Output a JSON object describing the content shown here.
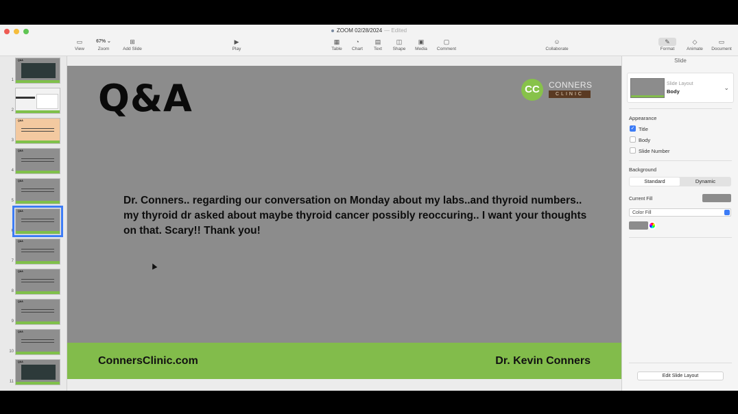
{
  "window": {
    "title": "ZOOM 02/28/2024",
    "status": "Edited"
  },
  "toolbar": {
    "view": "View",
    "zoom_value": "67%",
    "zoom": "Zoom",
    "add_slide": "Add Slide",
    "play": "Play",
    "table": "Table",
    "chart": "Chart",
    "text": "Text",
    "shape": "Shape",
    "media": "Media",
    "comment": "Comment",
    "collaborate": "Collaborate",
    "format": "Format",
    "animate": "Animate",
    "document": "Document"
  },
  "navigator": {
    "slides": [
      {
        "num": "1",
        "title": "Q&A",
        "style": "dark"
      },
      {
        "num": "2",
        "title": "",
        "style": "doc"
      },
      {
        "num": "3",
        "title": "Q&A",
        "style": "peach"
      },
      {
        "num": "4",
        "title": "Q&A",
        "style": "grey"
      },
      {
        "num": "5",
        "title": "Q&A",
        "style": "grey"
      },
      {
        "num": "6",
        "title": "Q&A",
        "style": "grey",
        "selected": true
      },
      {
        "num": "7",
        "title": "Q&A",
        "style": "grey"
      },
      {
        "num": "8",
        "title": "Q&A",
        "style": "grey"
      },
      {
        "num": "9",
        "title": "Q&A",
        "style": "grey"
      },
      {
        "num": "10",
        "title": "Q&A",
        "style": "grey"
      },
      {
        "num": "11",
        "title": "Q&A",
        "style": "dark"
      }
    ]
  },
  "slide": {
    "title": "Q&A",
    "body": "Dr. Conners.. regarding our conversation on Monday about my labs..and thyroid numbers.. my thyroid dr asked about maybe thyroid cancer possibly reoccuring.. I want your thoughts on that. Scary!! Thank you!",
    "footer_left": "ConnersClinic.com",
    "footer_right": "Dr. Kevin Conners",
    "logo_mark": "CC",
    "logo_top": "CONNERS",
    "logo_bottom": "CLINIC"
  },
  "inspector": {
    "header": "Slide",
    "layout_label": "Slide Layout",
    "layout_value": "Body",
    "appearance": "Appearance",
    "title_cb": "Title",
    "body_cb": "Body",
    "slide_number_cb": "Slide Number",
    "background": "Background",
    "standard": "Standard",
    "dynamic": "Dynamic",
    "current_fill": "Current Fill",
    "fill_type": "Color Fill",
    "edit_layout": "Edit Slide Layout"
  },
  "colors": {
    "slide_bg": "#8c8c8c",
    "footer_green": "#82bc4b",
    "accent_blue": "#3d7cf6"
  }
}
